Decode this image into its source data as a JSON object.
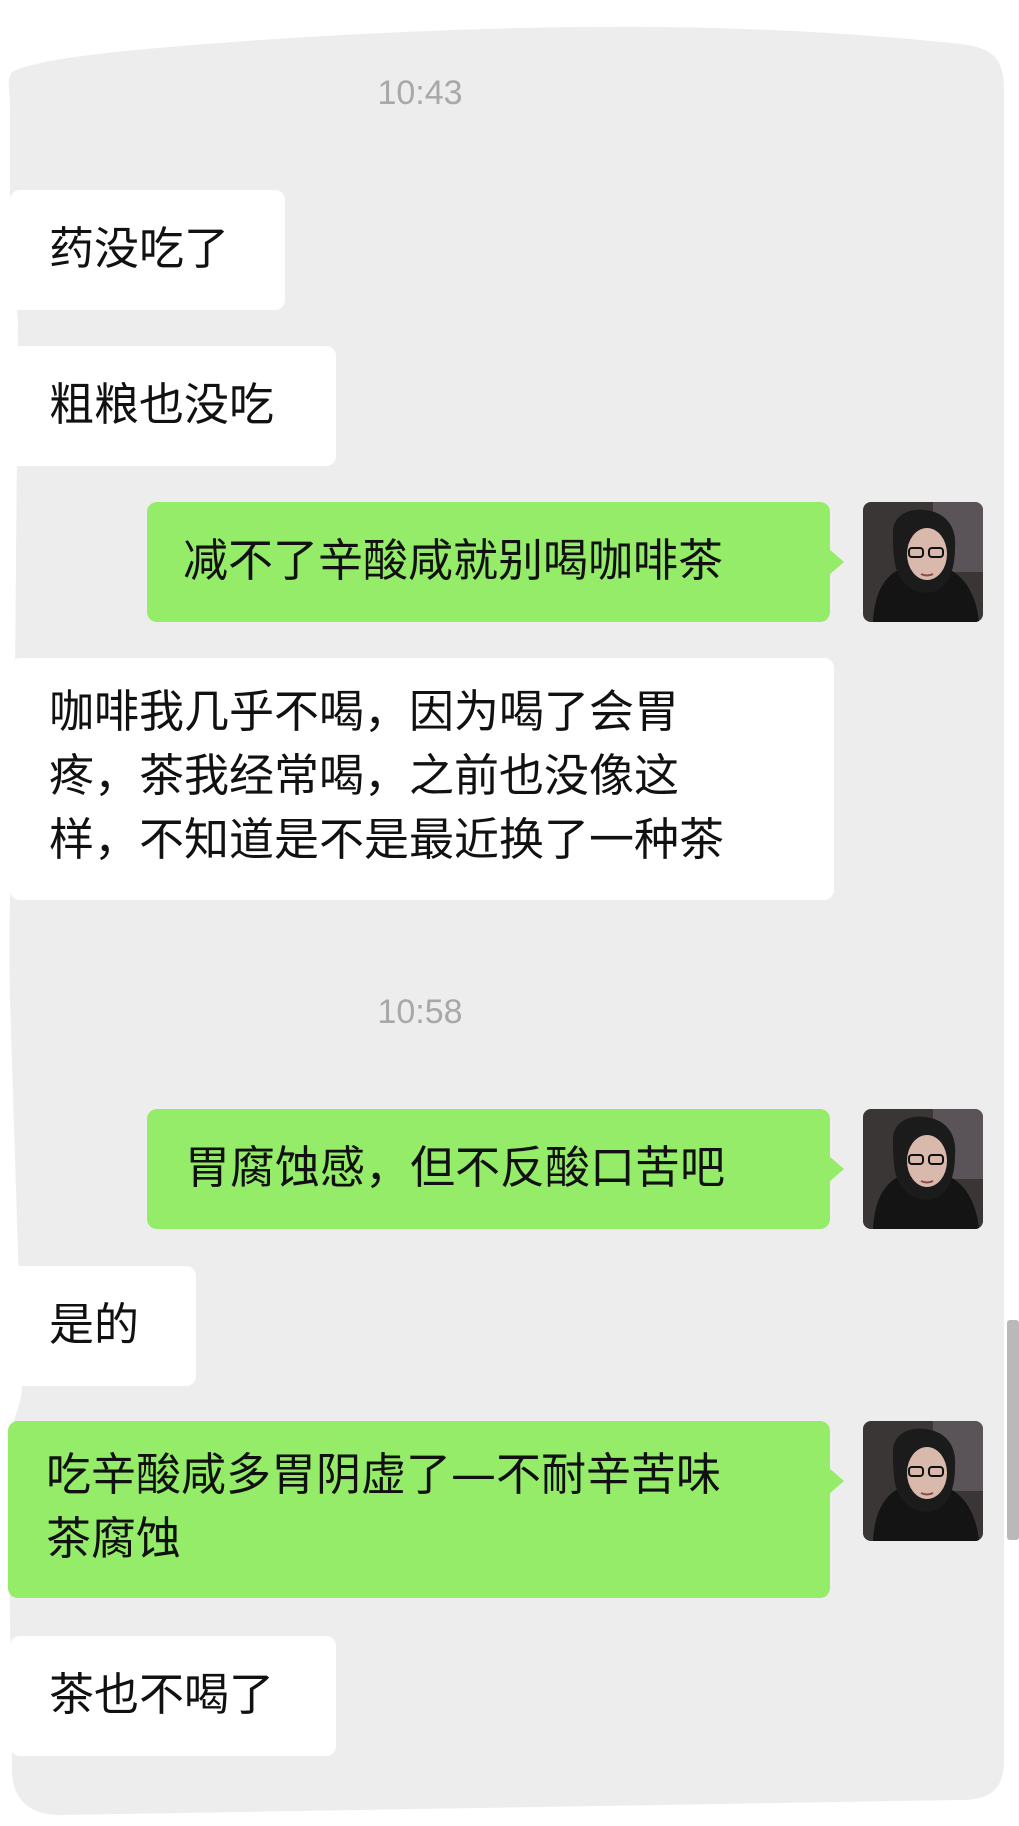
{
  "colors": {
    "chat_background": "#ededed",
    "incoming_bubble": "#ffffff",
    "outgoing_bubble": "#95ec69",
    "timestamp_text": "#a8a8a8"
  },
  "timestamps": [
    "10:43",
    "10:58"
  ],
  "messages": [
    {
      "direction": "incoming",
      "text": "药没吃了"
    },
    {
      "direction": "incoming",
      "text": "粗粮也没吃"
    },
    {
      "direction": "outgoing",
      "text": "减不了辛酸咸就别喝咖啡茶",
      "avatar": "user-avatar"
    },
    {
      "direction": "incoming",
      "text": "咖啡我几乎不喝，因为喝了会胃\n疼，茶我经常喝，之前也没像这\n样，不知道是不是最近换了一种茶"
    },
    {
      "direction": "outgoing",
      "text": "胃腐蚀感，但不反酸口苦吧",
      "avatar": "user-avatar"
    },
    {
      "direction": "incoming",
      "text": "是的"
    },
    {
      "direction": "outgoing",
      "text": "吃辛酸咸多胃阴虚了—不耐辛苦味\n茶腐蚀",
      "avatar": "user-avatar"
    },
    {
      "direction": "incoming",
      "text": "茶也不喝了"
    }
  ]
}
